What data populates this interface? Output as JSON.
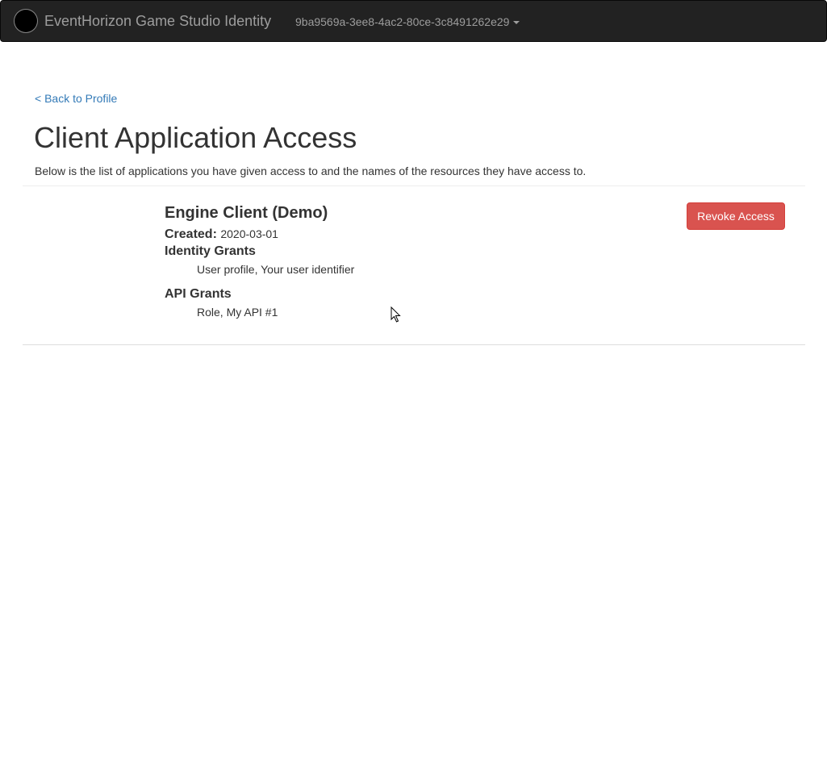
{
  "navbar": {
    "brand_title": "EventHorizon Game Studio Identity",
    "user_id": "9ba9569a-3ee8-4ac2-80ce-3c8491262e29",
    "logo_icon": "black-circle-logo",
    "dropdown_icon": "caret-down-icon"
  },
  "page": {
    "back_link": "< Back to Profile",
    "title": "Client Application Access",
    "description": "Below is the list of applications you have given access to and the names of the resources they have access to."
  },
  "grants": [
    {
      "client_name": "Engine Client (Demo)",
      "created_label": "Created:",
      "created_value": "2020-03-01",
      "identity_grants_title": "Identity Grants",
      "identity_grants_value": "User profile, Your user identifier",
      "api_grants_title": "API Grants",
      "api_grants_value": "Role, My API #1",
      "revoke_label": "Revoke Access"
    }
  ],
  "colors": {
    "navbar_bg": "#222222",
    "link": "#337ab7",
    "danger": "#d9534f"
  }
}
